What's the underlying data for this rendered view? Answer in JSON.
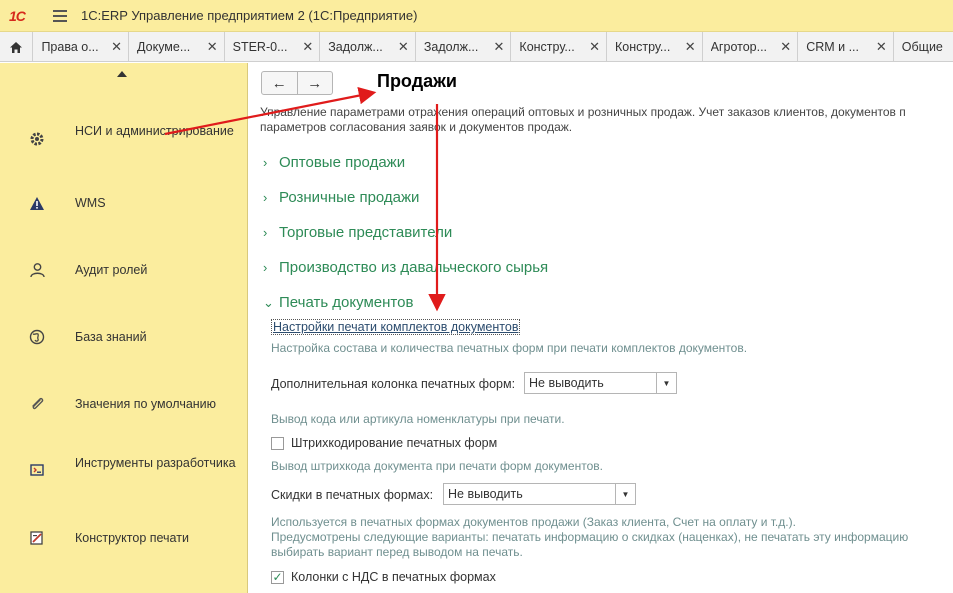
{
  "app": {
    "logo_text": "1С",
    "title": "1С:ERP Управление предприятием 2  (1С:Предприятие)"
  },
  "tabs": [
    {
      "label": "Права о..."
    },
    {
      "label": "Докуме..."
    },
    {
      "label": "STER-0..."
    },
    {
      "label": "Задолж..."
    },
    {
      "label": "Задолж..."
    },
    {
      "label": "Констру..."
    },
    {
      "label": "Констру..."
    },
    {
      "label": "Агротор..."
    },
    {
      "label": "CRM и ..."
    },
    {
      "label": "Общие"
    }
  ],
  "sidebar": {
    "items": [
      {
        "label": "НСИ и администрирование",
        "icon": "gear-icon"
      },
      {
        "label": "WMS",
        "icon": "warning-triangle-icon"
      },
      {
        "label": "Аудит ролей",
        "icon": "users-icon"
      },
      {
        "label": "База знаний",
        "icon": "globe-icon"
      },
      {
        "label": "Значения по умолчанию",
        "icon": "paperclip-icon"
      },
      {
        "label": "Инструменты разработчика",
        "icon": "tools-icon"
      },
      {
        "label": "Конструктор печати",
        "icon": "print-designer-icon"
      }
    ]
  },
  "content": {
    "nav_back": "←",
    "nav_forward": "→",
    "title": "Продажи",
    "description_line1": "Управление параметрами отражения операций оптовых и розничных продаж. Учет заказов клиентов, документов п",
    "description_line2": "параметров согласования заявок и документов продаж.",
    "sections": [
      {
        "label": "Оптовые продажи",
        "chevron": "›"
      },
      {
        "label": "Розничные продажи",
        "chevron": "›"
      },
      {
        "label": "Торговые представители",
        "chevron": "›"
      },
      {
        "label": "Производство из давальческого сырья",
        "chevron": "›"
      },
      {
        "label": "Печать документов",
        "chevron": "⌄"
      }
    ],
    "print_settings_link": "Настройки печати комплектов документов",
    "print_settings_note": "Настройка состава и количества печатных форм при печати комплектов документов.",
    "extra_column_label": "Дополнительная колонка печатных форм:",
    "extra_column_value": "Не выводить",
    "extra_column_note": "Вывод кода или артикула номенклатуры при печати.",
    "barcode_label": "Штрихкодирование печатных форм",
    "barcode_checked": false,
    "barcode_note": "Вывод штрихкода документа при печати форм документов.",
    "discounts_label": "Скидки в печатных формах:",
    "discounts_value": "Не выводить",
    "discounts_note1": "Используется в печатных формах документов продажи (Заказ клиента, Счет на оплату и т.д.).",
    "discounts_note2": "Предусмотрены следующие варианты: печатать информацию о скидках (наценках), не печатать эту информацию",
    "discounts_note3": "выбирать вариант перед выводом на печать.",
    "vat_label": "Колонки с НДС в печатных формах",
    "vat_checked": true
  },
  "colors": {
    "sidebar_bg": "#fbed9e",
    "section_green": "#2e8b57",
    "annotation_red": "#e01b1b"
  }
}
